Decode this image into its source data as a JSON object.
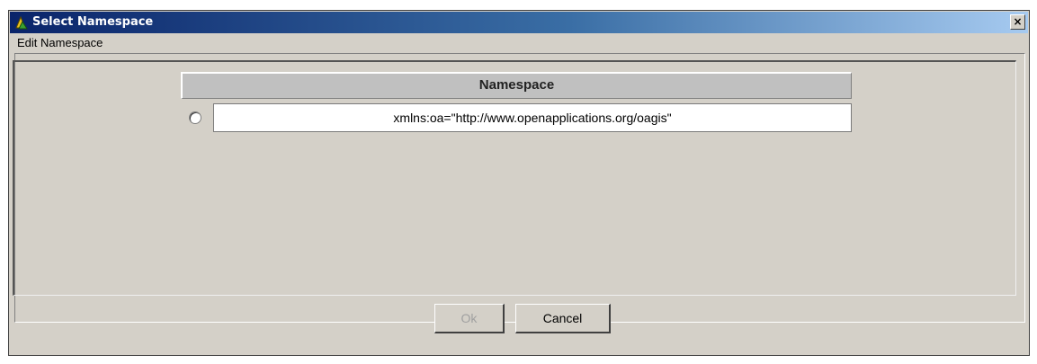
{
  "window": {
    "title": "Select Namespace",
    "title_icon": "app-icon",
    "close_label": "×"
  },
  "group": {
    "legend": "Edit Namespace"
  },
  "table": {
    "columns": [
      "Namespace"
    ],
    "rows": [
      {
        "selected": false,
        "namespace": "xmlns:oa=\"http://www.openapplications.org/oagis\""
      }
    ]
  },
  "buttons": {
    "ok_label": "Ok",
    "ok_enabled": false,
    "cancel_label": "Cancel"
  },
  "colors": {
    "titlebar_start": "#0a246a",
    "titlebar_end": "#a6caf0",
    "dialog_bg": "#d4d0c8"
  }
}
